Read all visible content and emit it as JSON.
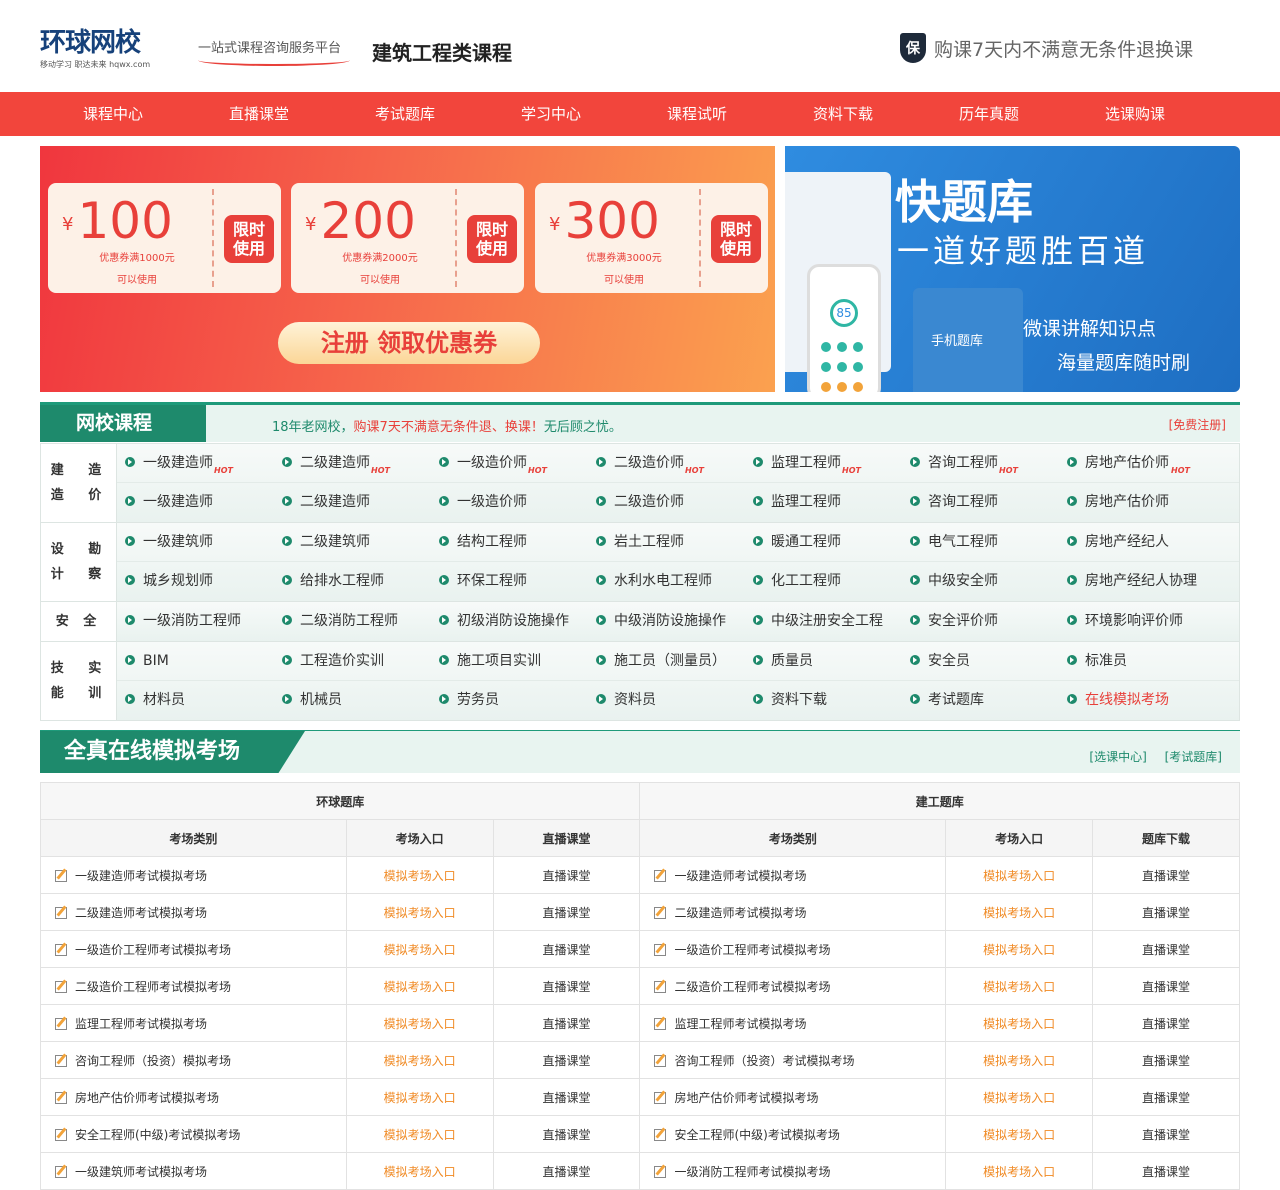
{
  "header": {
    "logo_text": "环球网校",
    "logo_tagline": "移动学习 职达未来 hqwx.com",
    "slogan": "一站式课程咨询服务平台",
    "title": "建筑工程类课程",
    "shield_char": "保",
    "guarantee": "购课7天内不满意无条件退换课"
  },
  "nav": [
    "课程中心",
    "直播课堂",
    "考试题库",
    "学习中心",
    "课程试听",
    "资料下载",
    "历年真题",
    "选课购课"
  ],
  "promo": {
    "coupons": [
      {
        "currency": "¥",
        "amount": "100",
        "condition": "优惠券满1000元",
        "note": "可以使用",
        "tag_line1": "限时",
        "tag_line2": "使用"
      },
      {
        "currency": "¥",
        "amount": "200",
        "condition": "优惠券满2000元",
        "note": "可以使用",
        "tag_line1": "限时",
        "tag_line2": "使用"
      },
      {
        "currency": "¥",
        "amount": "300",
        "condition": "优惠券满3000元",
        "note": "可以使用",
        "tag_line1": "限时",
        "tag_line2": "使用"
      }
    ],
    "register_button": "注册  领取优惠券"
  },
  "quiz_banner": {
    "title": "快题库",
    "subtitle": "一道好题胜百道",
    "app_label": "手机题库",
    "phone_score": "85",
    "line1": "微课讲解知识点",
    "line2": "海量题库随时刷"
  },
  "courses": {
    "section_title": "网校课程",
    "notice_prefix": "18年老网校，",
    "notice_red": "购课7天不满意无条件退、换课！",
    "notice_suffix": "无后顾之忧。",
    "register_link": "[免费注册]",
    "hot_text": "HOT",
    "categories": [
      {
        "label_line1": "建 造",
        "label_line2": "造 价",
        "lines": [
          [
            {
              "t": "一级建造师",
              "hot": true
            },
            {
              "t": "二级建造师",
              "hot": true
            },
            {
              "t": "一级造价师",
              "hot": true
            },
            {
              "t": "二级造价师",
              "hot": true
            },
            {
              "t": "监理工程师",
              "hot": true
            },
            {
              "t": "咨询工程师",
              "hot": true
            },
            {
              "t": "房地产估价师",
              "hot": true
            }
          ],
          [
            {
              "t": "一级建造师"
            },
            {
              "t": "二级建造师"
            },
            {
              "t": "一级造价师"
            },
            {
              "t": "二级造价师"
            },
            {
              "t": "监理工程师"
            },
            {
              "t": "咨询工程师"
            },
            {
              "t": "房地产估价师"
            }
          ]
        ]
      },
      {
        "label_line1": "设 计",
        "label_line2": "勘 察",
        "lines": [
          [
            {
              "t": "一级建筑师"
            },
            {
              "t": "二级建筑师"
            },
            {
              "t": "结构工程师"
            },
            {
              "t": "岩土工程师"
            },
            {
              "t": "暖通工程师"
            },
            {
              "t": "电气工程师"
            },
            {
              "t": "房地产经纪人"
            }
          ],
          [
            {
              "t": "城乡规划师"
            },
            {
              "t": "给排水工程师"
            },
            {
              "t": "环保工程师"
            },
            {
              "t": "水利水电工程师"
            },
            {
              "t": "化工工程师"
            },
            {
              "t": "中级安全师"
            },
            {
              "t": "房地产经纪人协理"
            }
          ]
        ]
      },
      {
        "label_line1": "安 全",
        "label_line2": "",
        "lines": [
          [
            {
              "t": "一级消防工程师"
            },
            {
              "t": "二级消防工程师"
            },
            {
              "t": "初级消防设施操作"
            },
            {
              "t": "中级消防设施操作"
            },
            {
              "t": "中级注册安全工程"
            },
            {
              "t": "安全评价师"
            },
            {
              "t": "环境影响评价师"
            }
          ]
        ]
      },
      {
        "label_line1": "技 能",
        "label_line2": "实 训",
        "lines": [
          [
            {
              "t": "BIM"
            },
            {
              "t": "工程造价实训"
            },
            {
              "t": "施工项目实训"
            },
            {
              "t": "施工员（测量员）"
            },
            {
              "t": "质量员"
            },
            {
              "t": "安全员"
            },
            {
              "t": "标准员"
            }
          ],
          [
            {
              "t": "材料员"
            },
            {
              "t": "机械员"
            },
            {
              "t": "劳务员"
            },
            {
              "t": "资料员"
            },
            {
              "t": "资料下载"
            },
            {
              "t": "考试题库"
            },
            {
              "t": "在线模拟考场",
              "red": true
            }
          ]
        ]
      }
    ]
  },
  "exam": {
    "section_title": "全真在线模拟考场",
    "link1": "[选课中心]",
    "link2": "[考试题库]",
    "group_left": "环球题库",
    "group_right": "建工题库",
    "columns_left": [
      "考场类别",
      "考场入口",
      "直播课堂"
    ],
    "columns_right": [
      "考场类别",
      "考场入口",
      "题库下载"
    ],
    "rows": [
      {
        "left": "一级建造师考试模拟考场",
        "entry": "模拟考场入口",
        "live": "直播课堂",
        "right": "一级建造师考试模拟考场",
        "entry2": "模拟考场入口",
        "live2": "直播课堂"
      },
      {
        "left": "二级建造师考试模拟考场",
        "entry": "模拟考场入口",
        "live": "直播课堂",
        "right": "二级建造师考试模拟考场",
        "entry2": "模拟考场入口",
        "live2": "直播课堂"
      },
      {
        "left": "一级造价工程师考试模拟考场",
        "entry": "模拟考场入口",
        "live": "直播课堂",
        "right": "一级造价工程师考试模拟考场",
        "entry2": "模拟考场入口",
        "live2": "直播课堂"
      },
      {
        "left": "二级造价工程师考试模拟考场",
        "entry": "模拟考场入口",
        "live": "直播课堂",
        "right": "二级造价工程师考试模拟考场",
        "entry2": "模拟考场入口",
        "live2": "直播课堂"
      },
      {
        "left": "监理工程师考试模拟考场",
        "entry": "模拟考场入口",
        "live": "直播课堂",
        "right": "监理工程师考试模拟考场",
        "entry2": "模拟考场入口",
        "live2": "直播课堂"
      },
      {
        "left": "咨询工程师（投资）模拟考场",
        "entry": "模拟考场入口",
        "live": "直播课堂",
        "right": "咨询工程师（投资）考试模拟考场",
        "entry2": "模拟考场入口",
        "live2": "直播课堂"
      },
      {
        "left": "房地产估价师考试模拟考场",
        "entry": "模拟考场入口",
        "live": "直播课堂",
        "right": "房地产估价师考试模拟考场",
        "entry2": "模拟考场入口",
        "live2": "直播课堂"
      },
      {
        "left": "安全工程师(中级)考试模拟考场",
        "entry": "模拟考场入口",
        "live": "直播课堂",
        "right": "安全工程师(中级)考试模拟考场",
        "entry2": "模拟考场入口",
        "live2": "直播课堂"
      },
      {
        "left": "一级建筑师考试模拟考场",
        "entry": "模拟考场入口",
        "live": "直播课堂",
        "right": "一级消防工程师考试模拟考场",
        "entry2": "模拟考场入口",
        "live2": "直播课堂"
      }
    ]
  }
}
